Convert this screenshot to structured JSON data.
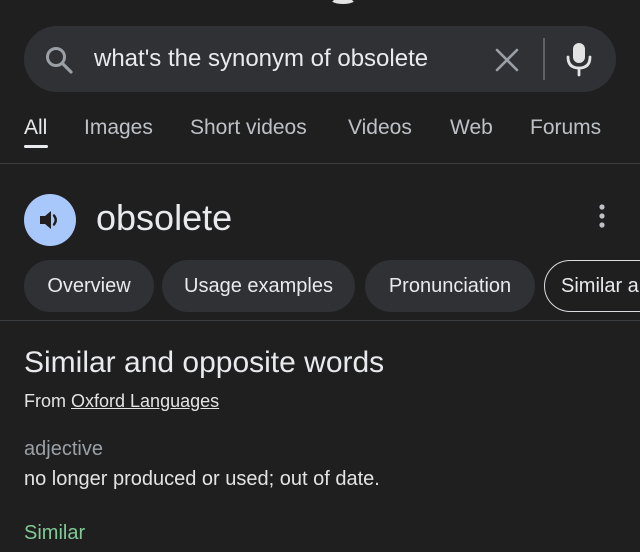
{
  "search": {
    "query": "what's the synonym of obsolete"
  },
  "tabs": [
    {
      "label": "All"
    },
    {
      "label": "Images"
    },
    {
      "label": "Short videos"
    },
    {
      "label": "Videos"
    },
    {
      "label": "Web"
    },
    {
      "label": "Forums"
    }
  ],
  "word": {
    "title": "obsolete"
  },
  "chips": [
    {
      "label": "Overview"
    },
    {
      "label": "Usage examples"
    },
    {
      "label": "Pronunciation"
    },
    {
      "label": "Similar a"
    }
  ],
  "content": {
    "section_title": "Similar and opposite words",
    "source_prefix": "From",
    "source_link": "Oxford Languages",
    "part_of_speech": "adjective",
    "definition": "no longer produced or used; out of date.",
    "similar_label": "Similar"
  },
  "icons": {
    "search": "search-icon",
    "clear": "close-icon",
    "mic": "microphone-icon",
    "speaker": "speaker-icon",
    "more": "more-vertical-icon"
  },
  "colors": {
    "background": "#1f1f1f",
    "search_bar": "#303134",
    "chip": "#303134",
    "speaker_accent": "#a8c7fa",
    "similar_green": "#81c995"
  }
}
